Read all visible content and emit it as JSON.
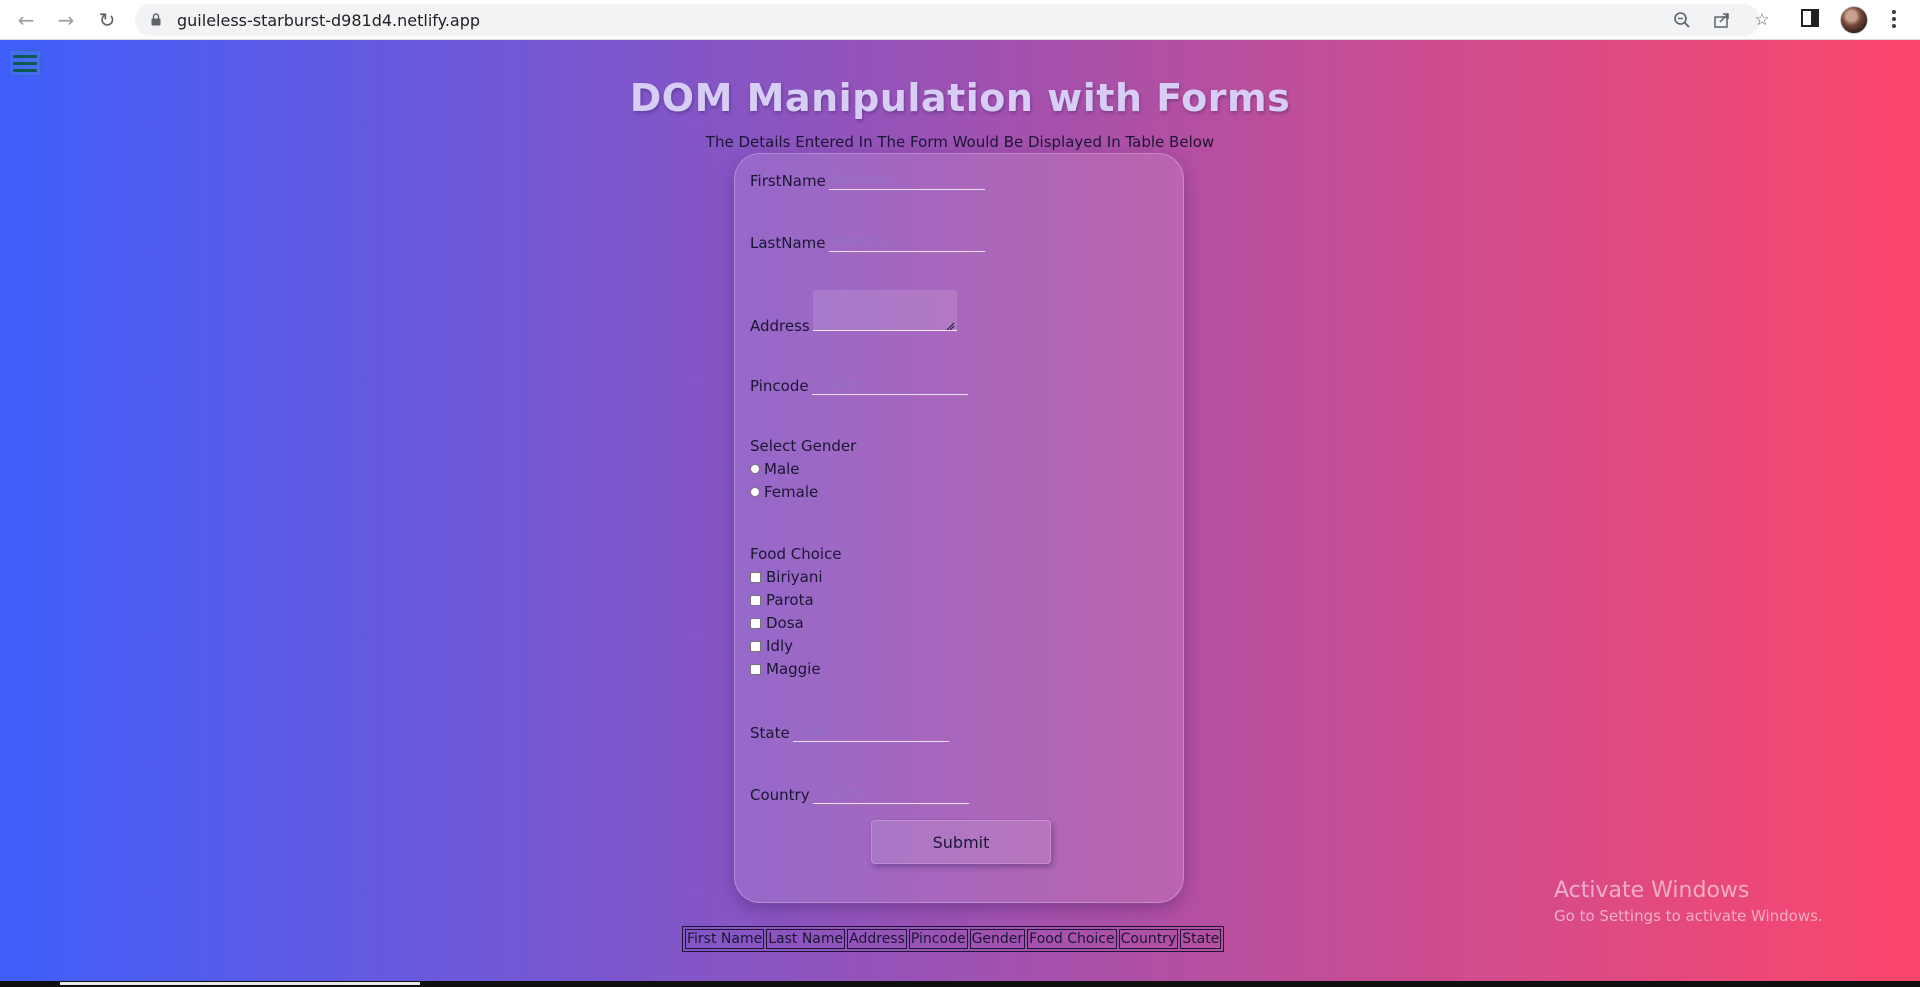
{
  "browser": {
    "url": "guileless-starburst-d981d4.netlify.app"
  },
  "page": {
    "title": "DOM Manipulation with Forms",
    "subtitle": "The Details Entered In The Form Would Be Displayed In Table Below"
  },
  "form": {
    "firstname_label": "FirstName",
    "lastname_label": "LastName",
    "address_label": "Address",
    "pincode_label": "Pincode",
    "gender_label": "Select Gender",
    "gender_options": [
      "Male",
      "Female"
    ],
    "food_label": "Food Choice",
    "food_options": [
      "Biriyani",
      "Parota",
      "Dosa",
      "Idly",
      "Maggie"
    ],
    "state_label": "State",
    "country_label": "Country",
    "submit_label": "Submit"
  },
  "table": {
    "headers": [
      "First Name",
      "Last Name",
      "Address",
      "Pincode",
      "Gender",
      "Food Choice",
      "Country",
      "State"
    ]
  },
  "watermark": {
    "line1": "Activate Windows",
    "line2": "Go to Settings to activate Windows."
  }
}
